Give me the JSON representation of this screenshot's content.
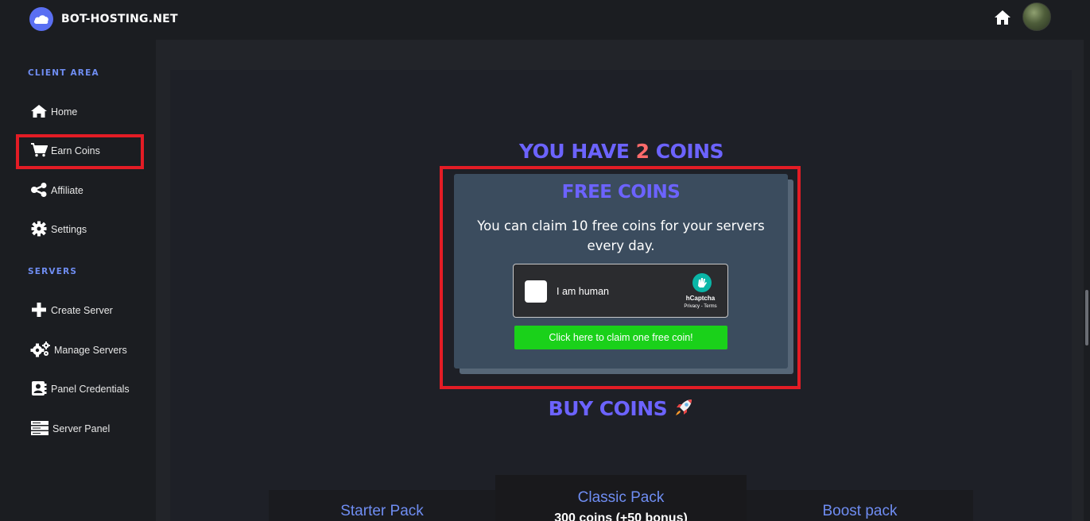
{
  "brand": {
    "name": "BOT-HOSTING.NET",
    "icon": "cloud-icon"
  },
  "header": {
    "home_icon": "home-icon",
    "avatar_icon": "avatar"
  },
  "sidebar": {
    "client_section": "CLIENT AREA",
    "servers_section": "SERVERS",
    "items": [
      {
        "label": "Home",
        "icon": "home-icon"
      },
      {
        "label": "Earn Coins",
        "icon": "cart-icon"
      },
      {
        "label": "Affiliate",
        "icon": "share-icon"
      },
      {
        "label": "Settings",
        "icon": "gear-icon"
      },
      {
        "label": "Create Server",
        "icon": "plus-icon"
      },
      {
        "label": "Manage Servers",
        "icon": "gears-icon"
      },
      {
        "label": "Panel Credentials",
        "icon": "address-book-icon"
      },
      {
        "label": "Server Panel",
        "icon": "server-icon"
      }
    ]
  },
  "coins": {
    "prefix": "YOU HAVE ",
    "count": "2",
    "suffix": " COINS"
  },
  "free_card": {
    "title": "FREE COINS",
    "description": "You can claim 10 free coins for your servers every day.",
    "captcha_label": "I am human",
    "captcha_brand": "hCaptcha",
    "captcha_links": "Privacy - Terms",
    "claim_button": "Click here to claim one free coin!"
  },
  "buy": {
    "heading": "BUY COINS",
    "icon": "rocket-icon"
  },
  "packs": [
    {
      "title": "Starter Pack"
    },
    {
      "title": "Classic Pack",
      "subtitle": "300 coins (+50 bonus)"
    },
    {
      "title": "Boost pack"
    }
  ],
  "colors": {
    "accent": "#6c63ff",
    "highlight": "#e31c25",
    "claim": "#1ad11a",
    "coin_count": "#ff6b6b"
  }
}
